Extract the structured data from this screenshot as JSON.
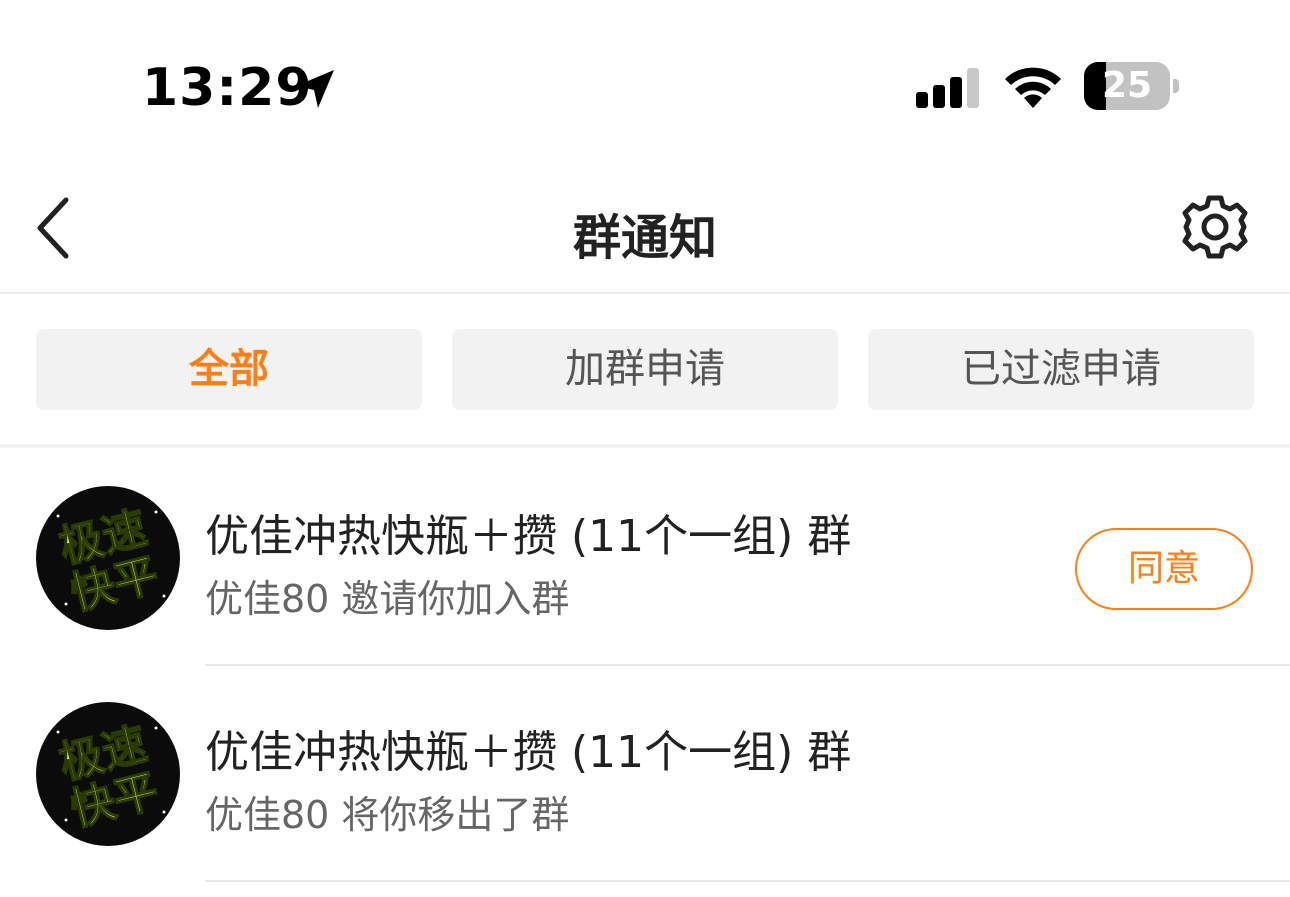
{
  "status_bar": {
    "time": "13:29",
    "battery_level": "25",
    "battery_fraction": 0.25,
    "icons": [
      "location-arrow-icon",
      "cellular-signal-icon",
      "wifi-icon",
      "battery-icon"
    ]
  },
  "header": {
    "title": "群通知",
    "back_icon": "chevron-left-icon",
    "settings_icon": "gear-icon"
  },
  "tabs": [
    {
      "label": "全部",
      "active": true
    },
    {
      "label": "加群申请",
      "active": false
    },
    {
      "label": "已过滤申请",
      "active": false
    }
  ],
  "notifications": [
    {
      "avatar_text_line1": "极速",
      "avatar_text_line2": "快平",
      "group_name": "优佳冲热快瓶＋攒 (11个一组) 群",
      "description": "优佳80 邀请你加入群",
      "action_label": "同意"
    },
    {
      "avatar_text_line1": "极速",
      "avatar_text_line2": "快平",
      "group_name": "优佳冲热快瓶＋攒 (11个一组) 群",
      "description": "优佳80 将你移出了群"
    }
  ],
  "colors": {
    "accent": "#ff7e14",
    "tab_bg": "#f2f2f2",
    "avatar_text": "#c8f04a",
    "divider": "#e8e8e8"
  }
}
